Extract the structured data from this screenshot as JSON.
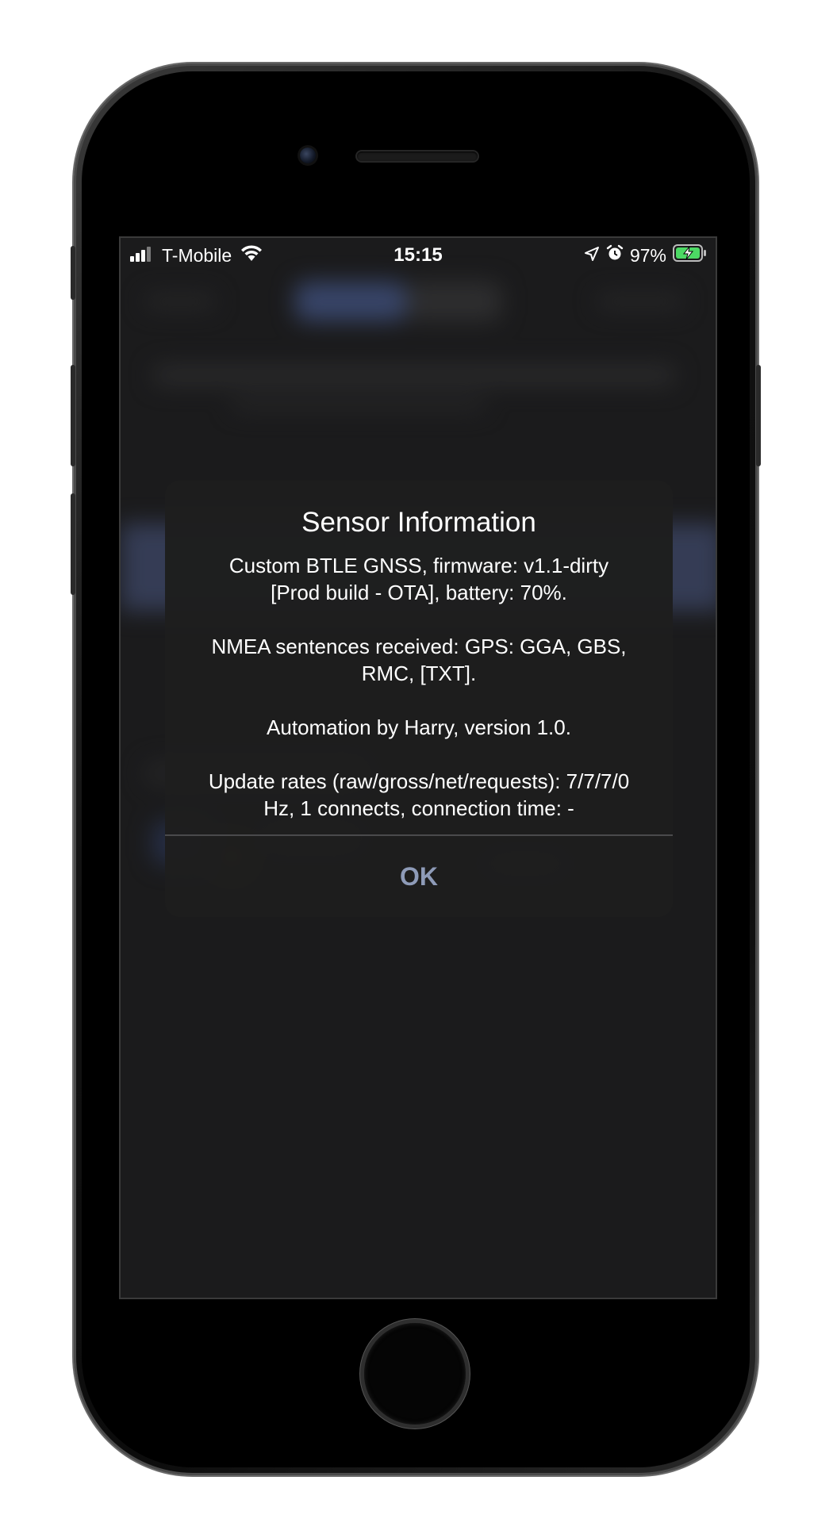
{
  "statusbar": {
    "carrier": "T-Mobile",
    "time": "15:15",
    "battery_percent": "97%",
    "icons": [
      "signal-icon",
      "wifi-icon",
      "location-arrow-icon",
      "alarm-icon",
      "battery-charging-icon"
    ]
  },
  "alert": {
    "title": "Sensor Information",
    "message": "Custom BTLE GNSS, firmware: v1.1-dirty\n[Prod build - OTA], battery: 70%.\n\nNMEA sentences received: GPS: GGA, GBS,\nRMC, [TXT].\n\nAutomation by Harry, version 1.0.\n\nUpdate rates (raw/gross/net/requests): 7/7/7/0\nHz, 1 connects, connection time: -",
    "ok_label": "OK"
  },
  "colors": {
    "accent": "#8e9bb8",
    "alert_bg": "#1e1e1e",
    "screen_bg": "#2c2c2e"
  }
}
